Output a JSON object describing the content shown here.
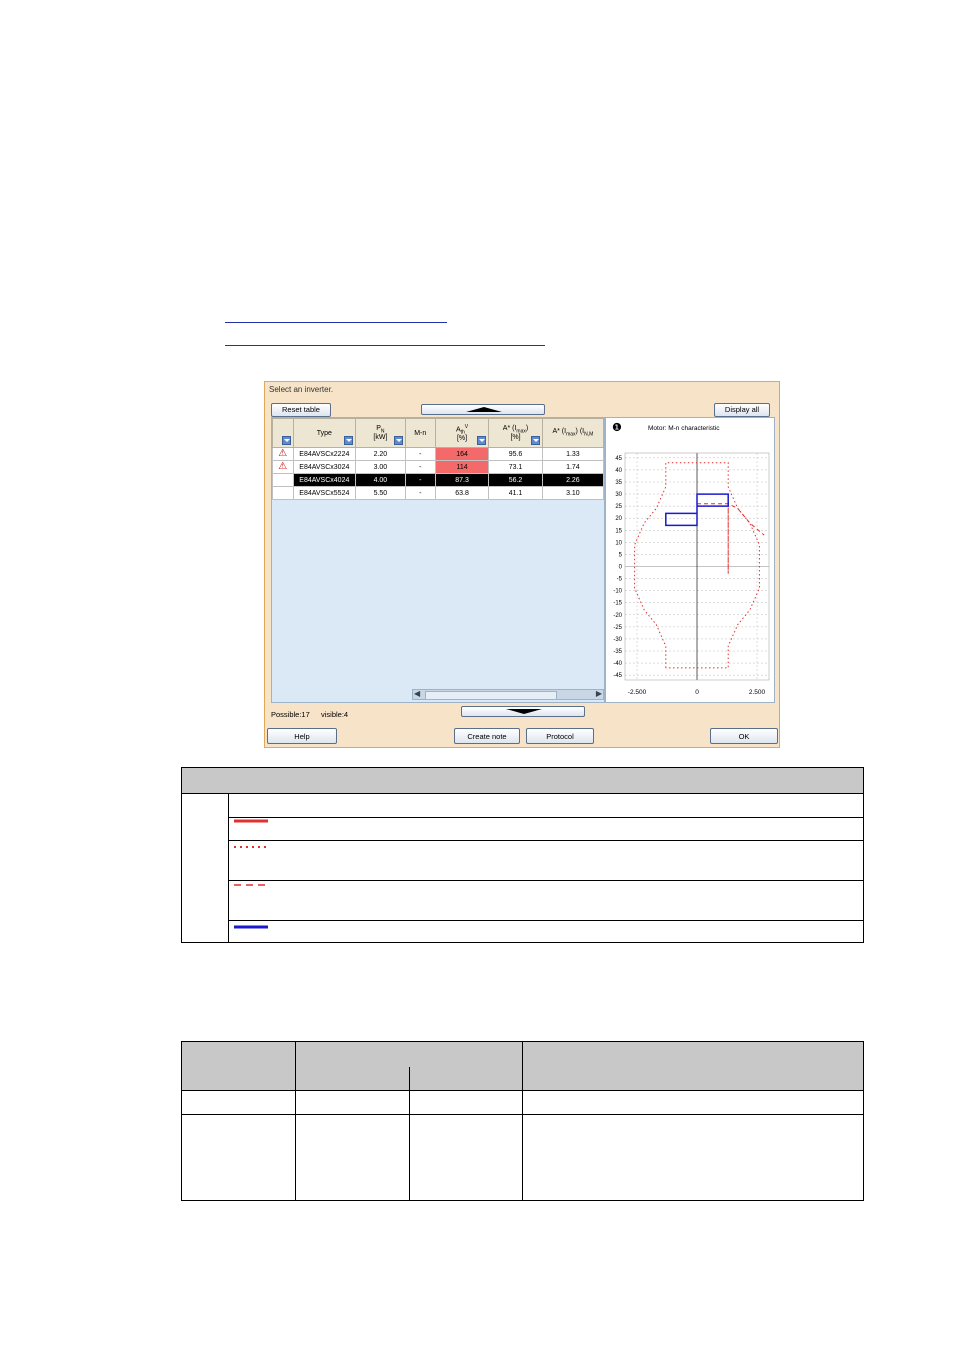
{
  "dialog": {
    "title": "Select an inverter.",
    "reset_table_label": "Reset table",
    "display_all_label": "Display all",
    "status_possible": "Possible:17",
    "status_visible": "visible:4",
    "help_label": "Help",
    "create_note_label": "Create note",
    "protocol_label": "Protocol",
    "ok_label": "OK"
  },
  "table": {
    "columns": [
      {
        "label": "Type",
        "sub": ""
      },
      {
        "label": "P",
        "sub": "N",
        "unit": "[kW]"
      },
      {
        "label": "M-n",
        "sub": ""
      },
      {
        "label": "A",
        "sub": "th",
        "sup": "V",
        "unit": "[%]"
      },
      {
        "label": "A* (I",
        "sub": "max",
        "tail": ")",
        "unit": "[%]"
      },
      {
        "label": "A* (I",
        "sub": "max",
        "tail": ") (I",
        "sub2": "N,M",
        "unit": ""
      }
    ],
    "rows": [
      {
        "warn": true,
        "type": "E84AVSCx2224",
        "p": "2.20",
        "mn": "-",
        "ath": "164",
        "amax": "95.6",
        "amax2": "1.33",
        "ath_hi": true,
        "selected": false
      },
      {
        "warn": true,
        "type": "E84AVSCx3024",
        "p": "3.00",
        "mn": "-",
        "ath": "114",
        "amax": "73.1",
        "amax2": "1.74",
        "ath_hi": true,
        "selected": false
      },
      {
        "warn": false,
        "type": "E84AVSCx4024",
        "p": "4.00",
        "mn": "-",
        "ath": "87.3",
        "amax": "56.2",
        "amax2": "2.26",
        "ath_hi": false,
        "selected": true
      },
      {
        "warn": false,
        "type": "E84AVSCx5524",
        "p": "5.50",
        "mn": "-",
        "ath": "63.8",
        "amax": "41.1",
        "amax2": "3.10",
        "ath_hi": false,
        "selected": false
      }
    ]
  },
  "chart": {
    "marker": "❶",
    "title": "Motor: M-n characteristic",
    "y_ticks": [
      "45",
      "40",
      "35",
      "30",
      "25",
      "20",
      "15",
      "10",
      "5",
      "0",
      "-5",
      "-10",
      "-15",
      "-20",
      "-25",
      "-30",
      "-35",
      "-40",
      "-45"
    ],
    "x_ticks": [
      "-2.500",
      "0",
      "2.500"
    ]
  },
  "chart_data": {
    "type": "line",
    "title": "Motor: M-n characteristic",
    "xlabel": "",
    "ylabel": "",
    "xlim": [
      -3000,
      3000
    ],
    "ylim": [
      -47,
      47
    ],
    "grid": true,
    "series": [
      {
        "style": "dotted",
        "color": "#e03030",
        "x": [
          -1300,
          -1300,
          -1700,
          -2200,
          -2600,
          -2600,
          -2200,
          -1700,
          -1300,
          -1300,
          1300,
          1300,
          1700,
          2200,
          2600,
          2600,
          2200,
          1700,
          1300,
          1300,
          -1300
        ],
        "y": [
          -42,
          -33,
          -24,
          -18,
          -9,
          9,
          18,
          24,
          33,
          43,
          43,
          33,
          24,
          18,
          9,
          -9,
          -18,
          -24,
          -33,
          -42,
          -42
        ]
      },
      {
        "style": "dashed",
        "color": "#e03030",
        "x": [
          0,
          1300,
          1300,
          1300,
          1300,
          1700,
          2200,
          2800
        ],
        "y": [
          26,
          26,
          26,
          -3,
          26,
          24,
          18,
          13
        ]
      },
      {
        "style": "solid",
        "color": "#1a1acc",
        "x": [
          -1300,
          0,
          0,
          -1300,
          -1300,
          0,
          0,
          1300,
          1300,
          0,
          0
        ],
        "y": [
          17,
          17,
          22,
          22,
          17,
          17,
          25,
          25,
          30,
          30,
          25
        ]
      }
    ]
  },
  "colors": {
    "accent_orange": "#e0a85c",
    "highlight_red": "#f46a6a",
    "selected_row": "#000000",
    "legend_red": "#e03030",
    "legend_blue": "#1a1acc"
  }
}
